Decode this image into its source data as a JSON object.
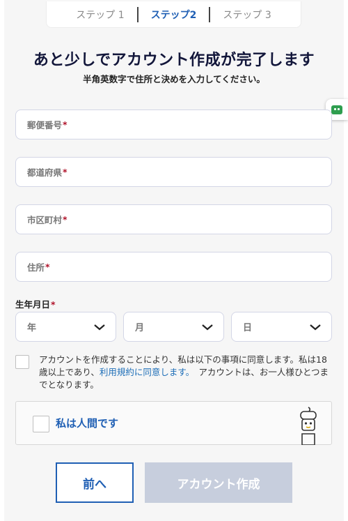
{
  "steps": [
    "ステップ 1",
    "ステップ2",
    "ステップ 3"
  ],
  "header": {
    "title": "あと少しでアカウント作成が完了します",
    "subtitle": "半角英数字で住所と決めを入力してください。"
  },
  "fields": {
    "postal": "郵便番号",
    "prefecture": "都道府県",
    "city": "市区町村",
    "address": "住所",
    "required_mark": "*"
  },
  "dob": {
    "label": "生年月日",
    "year": "年",
    "month": "月",
    "day": "日"
  },
  "terms": {
    "text1": "アカウントを作成することにより、私は以下の事項に同意します。私は18歳以上であり、",
    "link": "利用規約に同意します。",
    "text2": "　アカウントは、お一人様ひとつまでとなります。"
  },
  "captcha": {
    "label": "私は人間です"
  },
  "buttons": {
    "prev": "前へ",
    "create": "アカウント作成"
  },
  "colors": {
    "accent": "#1f5fb4",
    "required": "#b0132a",
    "disabled": "#c7cedd"
  }
}
